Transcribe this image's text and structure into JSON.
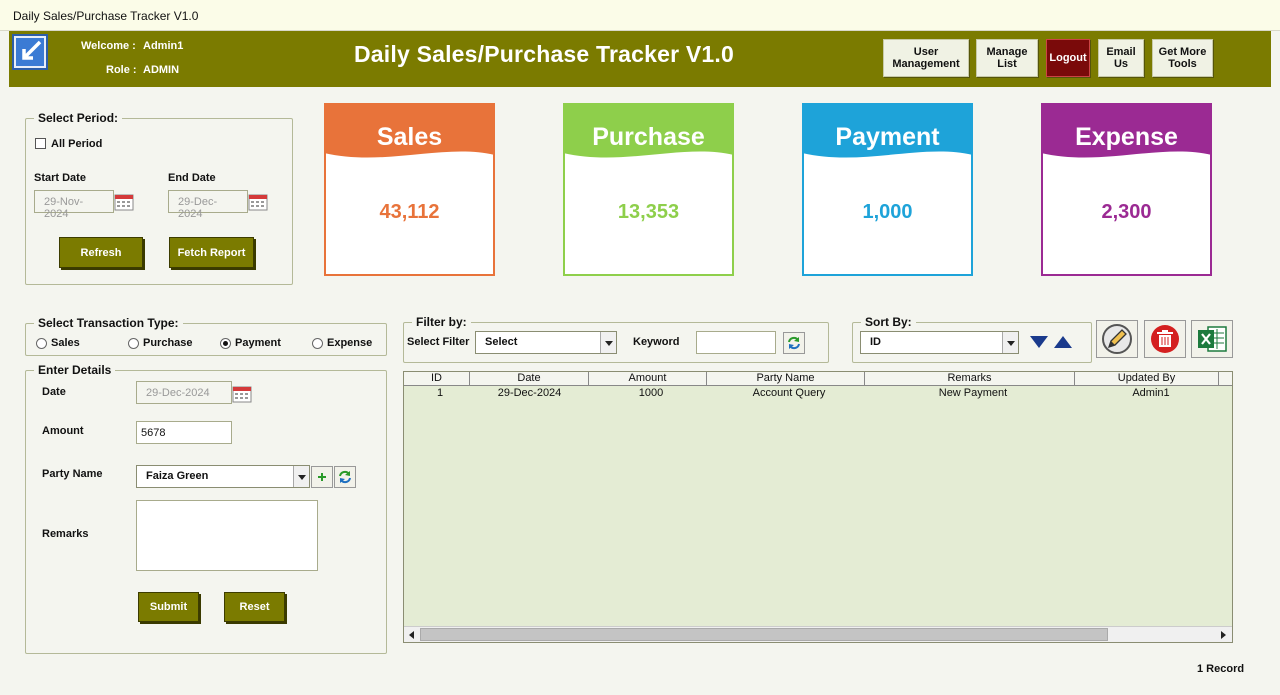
{
  "window": {
    "title": "Daily Sales/Purchase Tracker V1.0"
  },
  "header": {
    "welcome_label": "Welcome :",
    "welcome_value": "Admin1",
    "role_label": "Role :",
    "role_value": "ADMIN",
    "title": "Daily Sales/Purchase Tracker V1.0",
    "buttons": {
      "user_management": "User Management",
      "manage_list": "Manage List",
      "logout": "Logout",
      "email_us": "Email Us",
      "more_tools": "Get More Tools"
    }
  },
  "period": {
    "title": "Select Period:",
    "all_period": "All Period",
    "start_label": "Start Date",
    "start_value": "29-Nov-2024",
    "end_label": "End Date",
    "end_value": "29-Dec-2024",
    "refresh": "Refresh",
    "fetch": "Fetch Report"
  },
  "cards": [
    {
      "title": "Sales",
      "value": "43,112",
      "color": "#e8733a"
    },
    {
      "title": "Purchase",
      "value": "13,353",
      "color": "#8ecf4b"
    },
    {
      "title": "Payment",
      "value": "1,000",
      "color": "#1ea3d9"
    },
    {
      "title": "Expense",
      "value": "2,300",
      "color": "#9b2a93"
    }
  ],
  "transaction": {
    "title": "Select Transaction Type:",
    "options": [
      "Sales",
      "Purchase",
      "Payment",
      "Expense"
    ],
    "selected": "Payment"
  },
  "details": {
    "title": "Enter Details",
    "date_label": "Date",
    "date_value": "29-Dec-2024",
    "amount_label": "Amount",
    "amount_value": "5678",
    "party_label": "Party Name",
    "party_value": "Faiza Green",
    "remarks_label": "Remarks",
    "remarks_value": "",
    "submit": "Submit",
    "reset": "Reset"
  },
  "filter": {
    "title": "Filter by:",
    "select_label": "Select Filter",
    "select_value": "Select",
    "keyword_label": "Keyword",
    "keyword_value": ""
  },
  "sort": {
    "title": "Sort By:",
    "value": "ID"
  },
  "table": {
    "columns": [
      "ID",
      "Date",
      "Amount",
      "Party Name",
      "Remarks",
      "Updated By"
    ],
    "rows": [
      [
        "1",
        "29-Dec-2024",
        "1000",
        "Account Query",
        "New Payment",
        "Admin1"
      ]
    ]
  },
  "record_count": "1 Record"
}
